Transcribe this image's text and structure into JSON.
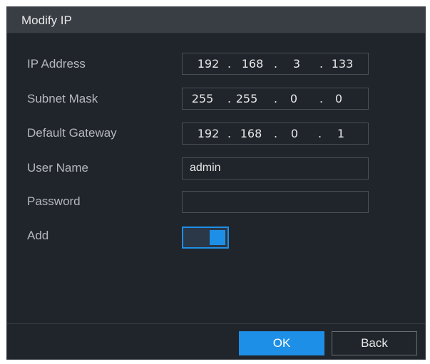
{
  "dialog": {
    "title": "Modify IP"
  },
  "fields": {
    "ip_address": {
      "label": "IP Address",
      "octets": [
        "192",
        "168",
        "3",
        "133"
      ]
    },
    "subnet_mask": {
      "label": "Subnet Mask",
      "octets": [
        "255",
        "255",
        "0",
        "0"
      ]
    },
    "default_gateway": {
      "label": "Default Gateway",
      "octets": [
        "192",
        "168",
        "0",
        "1"
      ]
    },
    "user_name": {
      "label": "User Name",
      "value": "admin"
    },
    "password": {
      "label": "Password",
      "value": ""
    },
    "add": {
      "label": "Add",
      "enabled": true
    }
  },
  "separator": ".",
  "buttons": {
    "ok": "OK",
    "back": "Back"
  },
  "colors": {
    "accent": "#1e8fe6",
    "background": "#20242b",
    "titlebar": "#393d44"
  }
}
